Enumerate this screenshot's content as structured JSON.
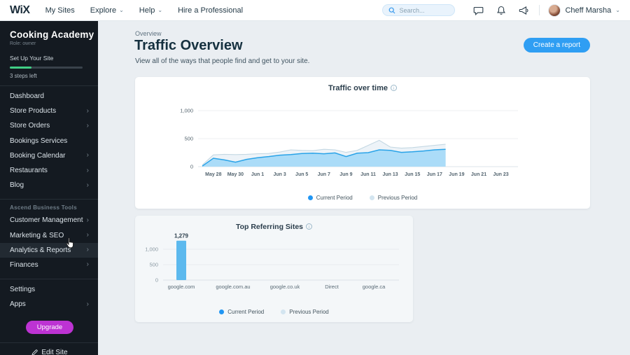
{
  "topbar": {
    "logo": "WiX",
    "nav": [
      {
        "label": "My Sites",
        "dropdown": false
      },
      {
        "label": "Explore",
        "dropdown": true
      },
      {
        "label": "Help",
        "dropdown": true
      },
      {
        "label": "Hire a Professional",
        "dropdown": false
      }
    ],
    "search_placeholder": "Search...",
    "user": {
      "name": "Cheff Marsha"
    }
  },
  "sidebar": {
    "site_name": "Cooking Academy",
    "role": "Role: owner",
    "setup": {
      "title": "Set Up Your Site",
      "steps_left": "3 steps left",
      "progress_pct": 30
    },
    "items_main": [
      {
        "label": "Dashboard",
        "chevron": false
      },
      {
        "label": "Store Products",
        "chevron": true
      },
      {
        "label": "Store Orders",
        "chevron": true
      },
      {
        "label": "Bookings Services",
        "chevron": false
      },
      {
        "label": "Booking Calendar",
        "chevron": true
      },
      {
        "label": "Restaurants",
        "chevron": true
      },
      {
        "label": "Blog",
        "chevron": true
      }
    ],
    "section_label": "Ascend Business Tools",
    "items_ascend": [
      {
        "label": "Customer Management",
        "chevron": true
      },
      {
        "label": "Marketing & SEO",
        "chevron": true
      },
      {
        "label": "Analytics & Reports",
        "chevron": true,
        "hovered": true
      },
      {
        "label": "Finances",
        "chevron": true
      }
    ],
    "items_bottom": [
      {
        "label": "Settings",
        "chevron": false
      },
      {
        "label": "Apps",
        "chevron": true
      }
    ],
    "upgrade_label": "Upgrade",
    "edit_site_label": "Edit Site"
  },
  "main": {
    "breadcrumb": "Overview",
    "title": "Traffic Overview",
    "subtitle": "View all of the ways that people find and get to your site.",
    "create_report_label": "Create a report"
  },
  "chart_data": [
    {
      "type": "area",
      "title": "Traffic over time",
      "x": [
        "May 27",
        "May 28",
        "May 29",
        "May 30",
        "May 31",
        "Jun 1",
        "Jun 2",
        "Jun 3",
        "Jun 4",
        "Jun 5",
        "Jun 6",
        "Jun 7",
        "Jun 8",
        "Jun 9",
        "Jun 10",
        "Jun 11",
        "Jun 12",
        "Jun 13",
        "Jun 14",
        "Jun 15",
        "Jun 16",
        "Jun 17",
        "Jun 18"
      ],
      "x_axis_tick_labels": [
        "May 28",
        "May 30",
        "Jun 1",
        "Jun 3",
        "Jun 5",
        "Jun 7",
        "Jun 9",
        "Jun 11",
        "Jun 13",
        "Jun 15",
        "Jun 17",
        "Jun 19",
        "Jun 21",
        "Jun 23"
      ],
      "series": [
        {
          "name": "Previous Period",
          "line_color": "#c4d8e3",
          "fill_color": "#e7eff5",
          "legend_color": "#d3e5f0",
          "values": [
            30,
            210,
            220,
            215,
            220,
            230,
            235,
            260,
            300,
            290,
            285,
            310,
            300,
            255,
            290,
            380,
            470,
            350,
            330,
            340,
            360,
            380,
            400
          ]
        },
        {
          "name": "Current Period",
          "line_color": "#29a3e8",
          "fill_color": "#a8daf8",
          "legend_color": "#2196f3",
          "values": [
            10,
            150,
            120,
            80,
            130,
            160,
            180,
            205,
            215,
            235,
            240,
            230,
            245,
            180,
            240,
            250,
            300,
            290,
            255,
            265,
            280,
            300,
            310
          ]
        }
      ],
      "ylim": [
        0,
        1000
      ],
      "yticks": [
        0,
        500,
        1000
      ],
      "ytick_labels": [
        "0",
        "500",
        "1,000"
      ],
      "legend": [
        "Current Period",
        "Previous Period"
      ],
      "legend_position": "bottom",
      "grid": true
    },
    {
      "type": "bar",
      "title": "Top Referring Sites",
      "categories": [
        "google.com",
        "google.com.au",
        "google.co.uk",
        "Direct",
        "google.ca"
      ],
      "series": [
        {
          "name": "Current Period",
          "color": "#5cb9ee",
          "legend_color": "#2196f3",
          "values": [
            1279,
            0,
            0,
            0,
            0
          ]
        },
        {
          "name": "Previous Period",
          "color": "#dfe9f0",
          "legend_color": "#d3e5f0",
          "values": [
            0,
            0,
            0,
            0,
            0
          ]
        }
      ],
      "value_labels": [
        "1,279",
        "",
        "",
        "",
        ""
      ],
      "ylim": [
        0,
        1300
      ],
      "yticks": [
        0,
        500,
        1000
      ],
      "ytick_labels": [
        "0",
        "500",
        "1,000"
      ],
      "legend": [
        "Current Period",
        "Previous Period"
      ],
      "legend_position": "bottom",
      "grid": true
    }
  ]
}
